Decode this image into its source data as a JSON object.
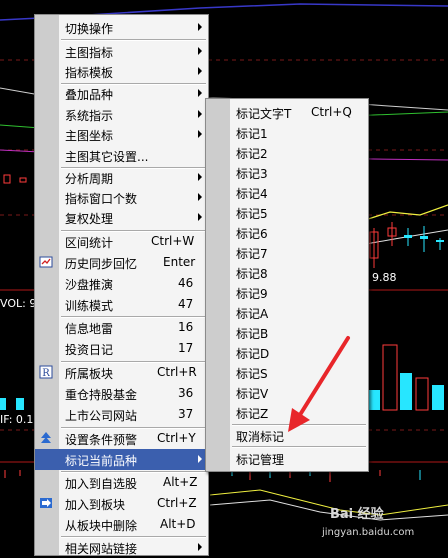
{
  "background": {
    "price_label": "9.88",
    "vol_label": "VOL: 9",
    "indicator_label": "IF: 0.1",
    "watermark": "jingyan.baidu.com",
    "watermark_brand": "Bai 经验"
  },
  "main_menu": {
    "items": [
      {
        "label": "切换操作",
        "shortcut": "",
        "submenu": true
      },
      {
        "label": "主图指标",
        "shortcut": "",
        "submenu": true
      },
      {
        "label": "指标模板",
        "shortcut": "",
        "submenu": true
      },
      {
        "label": "叠加品种",
        "shortcut": "",
        "submenu": true
      },
      {
        "label": "系统指示",
        "shortcut": "",
        "submenu": true
      },
      {
        "label": "主图坐标",
        "shortcut": "",
        "submenu": true
      },
      {
        "label": "主图其它设置...",
        "shortcut": "",
        "submenu": false
      },
      {
        "label": "分析周期",
        "shortcut": "",
        "submenu": true
      },
      {
        "label": "指标窗口个数",
        "shortcut": "",
        "submenu": true
      },
      {
        "label": "复权处理",
        "shortcut": "",
        "submenu": true
      },
      {
        "label": "区间统计",
        "shortcut": "Ctrl+W",
        "submenu": false
      },
      {
        "label": "历史同步回忆",
        "shortcut": "Enter",
        "submenu": false
      },
      {
        "label": "沙盘推演",
        "shortcut": "46",
        "submenu": false
      },
      {
        "label": "训练模式",
        "shortcut": "47",
        "submenu": false
      },
      {
        "label": "信息地雷",
        "shortcut": "16",
        "submenu": false
      },
      {
        "label": "投资日记",
        "shortcut": "17",
        "submenu": false
      },
      {
        "label": "所属板块",
        "shortcut": "Ctrl+R",
        "submenu": false
      },
      {
        "label": "重仓持股基金",
        "shortcut": "36",
        "submenu": false
      },
      {
        "label": "上市公司网站",
        "shortcut": "37",
        "submenu": false
      },
      {
        "label": "设置条件预警",
        "shortcut": "Ctrl+Y",
        "submenu": false
      },
      {
        "label": "标记当前品种",
        "shortcut": "",
        "submenu": true
      },
      {
        "label": "加入到自选股",
        "shortcut": "Alt+Z",
        "submenu": false
      },
      {
        "label": "加入到板块",
        "shortcut": "Ctrl+Z",
        "submenu": false
      },
      {
        "label": "从板块中删除",
        "shortcut": "Alt+D",
        "submenu": false
      },
      {
        "label": "相关网站链接",
        "shortcut": "",
        "submenu": true
      }
    ]
  },
  "sub_menu": {
    "items": [
      {
        "label": "标记文字T",
        "shortcut": "Ctrl+Q"
      },
      {
        "label": "标记1",
        "shortcut": ""
      },
      {
        "label": "标记2",
        "shortcut": ""
      },
      {
        "label": "标记3",
        "shortcut": ""
      },
      {
        "label": "标记4",
        "shortcut": ""
      },
      {
        "label": "标记5",
        "shortcut": ""
      },
      {
        "label": "标记6",
        "shortcut": ""
      },
      {
        "label": "标记7",
        "shortcut": ""
      },
      {
        "label": "标记8",
        "shortcut": ""
      },
      {
        "label": "标记9",
        "shortcut": ""
      },
      {
        "label": "标记A",
        "shortcut": ""
      },
      {
        "label": "标记B",
        "shortcut": ""
      },
      {
        "label": "标记D",
        "shortcut": ""
      },
      {
        "label": "标记S",
        "shortcut": ""
      },
      {
        "label": "标记V",
        "shortcut": ""
      },
      {
        "label": "标记Z",
        "shortcut": ""
      },
      {
        "label": "取消标记",
        "shortcut": ""
      },
      {
        "label": "标记管理",
        "shortcut": ""
      }
    ]
  },
  "colors": {
    "highlight": "#3b5fae",
    "arrow": "#e8262a",
    "chart_red": "#ff3b3b",
    "chart_cyan": "#27e6ff"
  },
  "icons": {
    "interval": "interval-stats-icon",
    "history": "history-sync-icon",
    "sector": "sector-R-icon",
    "alert": "alert-icon",
    "add_sector": "add-to-sector-icon"
  }
}
